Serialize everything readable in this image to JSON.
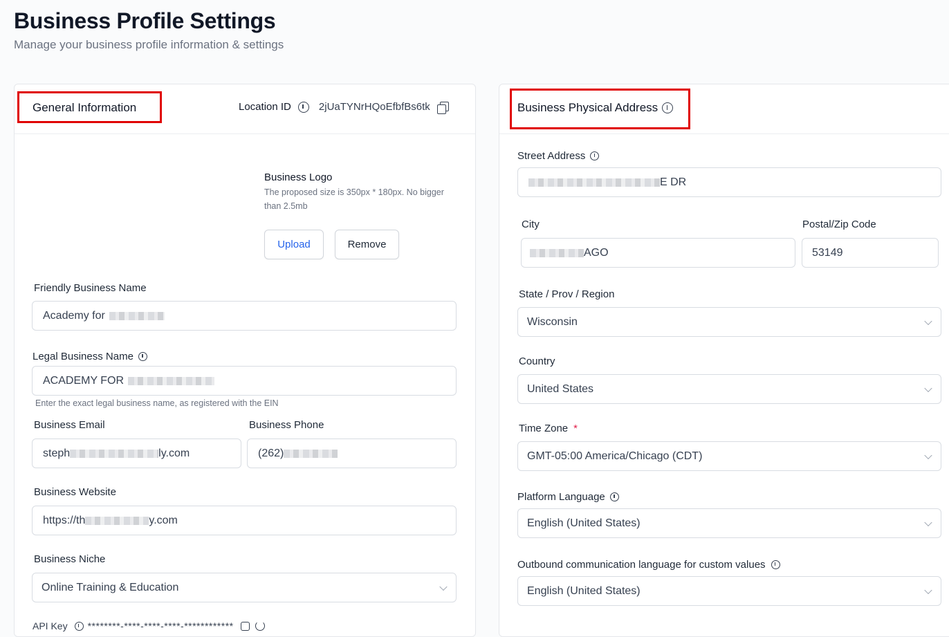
{
  "header": {
    "title": "Business Profile Settings",
    "subtitle": "Manage your business profile information & settings"
  },
  "general": {
    "title": "General Information",
    "location_label": "Location ID",
    "location_id": "2jUaTYNrHQoEfbfBs6tk",
    "logo_title": "Business Logo",
    "logo_hint": "The proposed size is 350px * 180px. No bigger than 2.5mb",
    "upload_label": "Upload",
    "remove_label": "Remove",
    "friendly_name_label": "Friendly Business Name",
    "friendly_name_value": "Academy for",
    "legal_name_label": "Legal Business Name",
    "legal_name_value": "ACADEMY FOR",
    "legal_name_hint": "Enter the exact legal business name, as registered with the EIN",
    "email_label": "Business Email",
    "email_prefix": "steph",
    "email_suffix": "ly.com",
    "phone_label": "Business Phone",
    "phone_prefix": "(262)",
    "website_label": "Business Website",
    "website_prefix": "https://th",
    "website_suffix": "y.com",
    "niche_label": "Business Niche",
    "niche_value": "Online Training & Education",
    "api_key_label": "API Key",
    "api_key_mask": "********-****-****-****-************"
  },
  "address": {
    "title": "Business Physical Address",
    "street_label": "Street Address",
    "street_suffix": "E DR",
    "city_label": "City",
    "city_suffix": "AGO",
    "postal_label": "Postal/Zip Code",
    "postal_value": "53149",
    "state_label": "State / Prov / Region",
    "state_value": "Wisconsin",
    "country_label": "Country",
    "country_value": "United States",
    "timezone_label": "Time Zone",
    "timezone_required": "*",
    "timezone_value": "GMT-05:00 America/Chicago (CDT)",
    "platform_lang_label": "Platform Language",
    "platform_lang_value": "English (United States)",
    "outbound_lang_label": "Outbound communication language for custom values",
    "outbound_lang_value": "English (United States)"
  },
  "colors": {
    "highlight": "#e00000",
    "link_blue": "#2563eb",
    "required_red": "#e11d48"
  },
  "icons": [
    "info-icon",
    "copy-icon",
    "chevron-down-icon",
    "clipboard-icon",
    "refresh-icon"
  ]
}
